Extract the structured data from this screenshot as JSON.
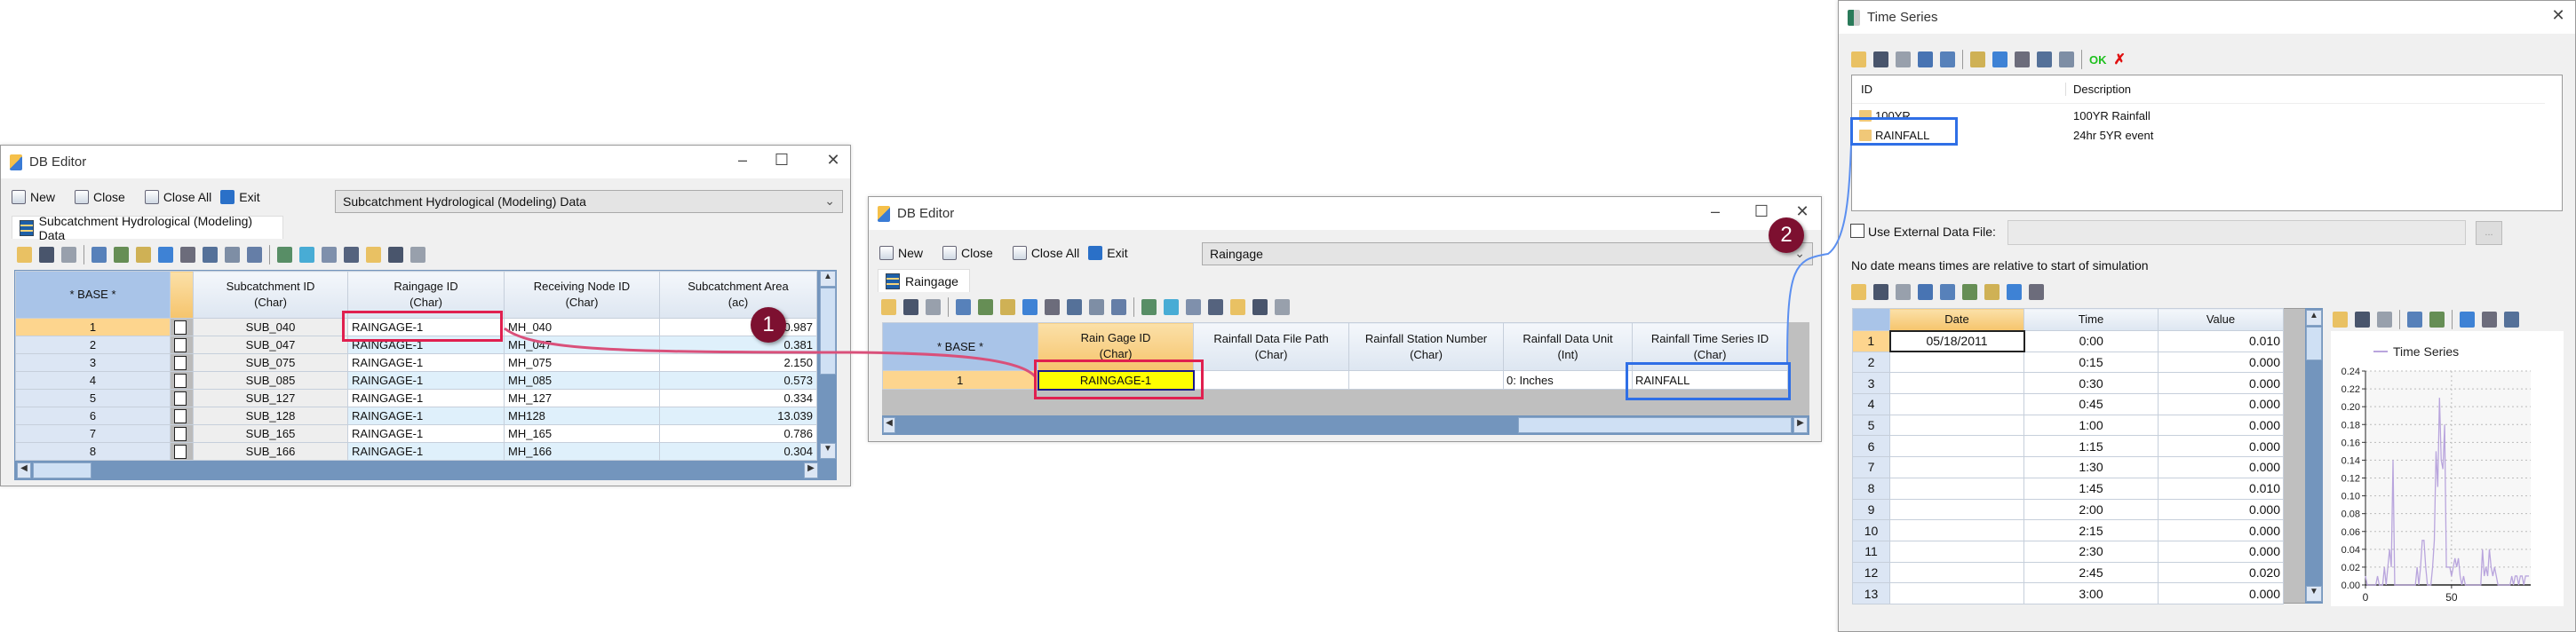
{
  "window1": {
    "title": "DB Editor",
    "toolbar": {
      "new": "New",
      "close": "Close",
      "close_all": "Close All",
      "exit": "Exit"
    },
    "table_select": "Subcatchment Hydrological (Modeling) Data",
    "tab": "Subcatchment Hydrological (Modeling) Data",
    "grid": {
      "base_header": "* BASE *",
      "columns": [
        {
          "name": "Subcatchment ID",
          "type": "(Char)"
        },
        {
          "name": "Raingage ID",
          "type": "(Char)"
        },
        {
          "name": "Receiving Node ID",
          "type": "(Char)"
        },
        {
          "name": "Subcatchment Area",
          "type": "(ac)"
        }
      ],
      "rows": [
        [
          "1",
          "SUB_040",
          "RAINGAGE-1",
          "MH_040",
          "0.987"
        ],
        [
          "2",
          "SUB_047",
          "RAINGAGE-1",
          "MH_047",
          "0.381"
        ],
        [
          "3",
          "SUB_075",
          "RAINGAGE-1",
          "MH_075",
          "2.150"
        ],
        [
          "4",
          "SUB_085",
          "RAINGAGE-1",
          "MH_085",
          "0.573"
        ],
        [
          "5",
          "SUB_127",
          "RAINGAGE-1",
          "MH_127",
          "0.334"
        ],
        [
          "6",
          "SUB_128",
          "RAINGAGE-1",
          "MH128",
          "13.039"
        ],
        [
          "7",
          "SUB_165",
          "RAINGAGE-1",
          "MH_165",
          "0.786"
        ],
        [
          "8",
          "SUB_166",
          "RAINGAGE-1",
          "MH_166",
          "0.304"
        ]
      ]
    }
  },
  "window2": {
    "title": "DB Editor",
    "toolbar": {
      "new": "New",
      "close": "Close",
      "close_all": "Close All",
      "exit": "Exit"
    },
    "table_select": "Raingage",
    "tab": "Raingage",
    "grid": {
      "base_header": "* BASE *",
      "columns": [
        {
          "name": "Rain Gage ID",
          "type": "(Char)"
        },
        {
          "name": "Rainfall Data File Path",
          "type": "(Char)"
        },
        {
          "name": "Rainfall Station Number",
          "type": "(Char)"
        },
        {
          "name": "Rainfall Data Unit",
          "type": "(Int)"
        },
        {
          "name": "Rainfall Time Series ID",
          "type": "(Char)"
        }
      ],
      "rows": [
        [
          "1",
          "RAINGAGE-1",
          "",
          "",
          "0: Inches",
          "RAINFALL"
        ]
      ]
    }
  },
  "window3": {
    "title": "Time Series",
    "ok_label": "OK",
    "list": {
      "headers": [
        "ID",
        "Description"
      ],
      "items": [
        {
          "id": "100YR",
          "description": "100YR Rainfall"
        },
        {
          "id": "RAINFALL",
          "description": "24hr 5YR event"
        }
      ]
    },
    "external_file_label": "Use External Data File:",
    "external_file_value": "",
    "browse_label": "...",
    "note": "No date means times are relative to start of simulation",
    "grid": {
      "headers": [
        "Date",
        "Time",
        "Value"
      ],
      "rows": [
        [
          "1",
          "05/18/2011",
          "0:00",
          "0.010"
        ],
        [
          "2",
          "",
          "0:15",
          "0.000"
        ],
        [
          "3",
          "",
          "0:30",
          "0.000"
        ],
        [
          "4",
          "",
          "0:45",
          "0.000"
        ],
        [
          "5",
          "",
          "1:00",
          "0.000"
        ],
        [
          "6",
          "",
          "1:15",
          "0.000"
        ],
        [
          "7",
          "",
          "1:30",
          "0.000"
        ],
        [
          "8",
          "",
          "1:45",
          "0.010"
        ],
        [
          "9",
          "",
          "2:00",
          "0.000"
        ],
        [
          "10",
          "",
          "2:15",
          "0.000"
        ],
        [
          "11",
          "",
          "2:30",
          "0.000"
        ],
        [
          "12",
          "",
          "2:45",
          "0.020"
        ],
        [
          "13",
          "",
          "3:00",
          "0.000"
        ]
      ]
    }
  },
  "callouts": [
    "1",
    "2"
  ],
  "colors": {
    "callout": "#7d1030",
    "red_highlight": "#e0204f",
    "blue_highlight": "#2f6fe6",
    "series": "#b9a5dd",
    "selected_cell": "#ffff00"
  },
  "chart_data": {
    "type": "line",
    "legend": [
      "Time Series"
    ],
    "legend_position": "top",
    "ylim": [
      0,
      0.24
    ],
    "xlim": [
      0,
      96
    ],
    "yticks": [
      "0.00",
      "0.02",
      "0.04",
      "0.06",
      "0.08",
      "0.10",
      "0.12",
      "0.14",
      "0.16",
      "0.18",
      "0.20",
      "0.22",
      "0.24"
    ],
    "xticks": [
      "0",
      "50"
    ],
    "grid": true,
    "series": [
      {
        "name": "Time Series",
        "values": [
          0.01,
          0,
          0,
          0,
          0,
          0,
          0,
          0.01,
          0,
          0,
          0,
          0.02,
          0,
          0.02,
          0.04,
          0.02,
          0.14,
          0,
          0,
          0,
          0,
          0,
          0,
          0,
          0,
          0,
          0,
          0,
          0,
          0,
          0.02,
          0,
          0.02,
          0.05,
          0.05,
          0.02,
          0,
          0,
          0,
          0.02,
          0.05,
          0.15,
          0.11,
          0.21,
          0.14,
          0.13,
          0.18,
          0.02,
          0.02,
          0.02,
          0.01,
          0.02,
          0.03,
          0.02,
          0.03,
          0.01,
          0,
          0.01,
          0,
          0,
          0,
          0,
          0,
          0,
          0,
          0,
          0,
          0,
          0.04,
          0.01,
          0.02,
          0.01,
          0.04,
          0.02,
          0.01,
          0.02,
          0.01,
          0,
          0,
          0,
          0,
          0,
          0,
          0,
          0,
          0.01,
          0,
          0.01,
          0.01,
          0,
          0.01,
          0.01,
          0,
          0.01,
          0.01,
          0.01
        ]
      }
    ]
  }
}
